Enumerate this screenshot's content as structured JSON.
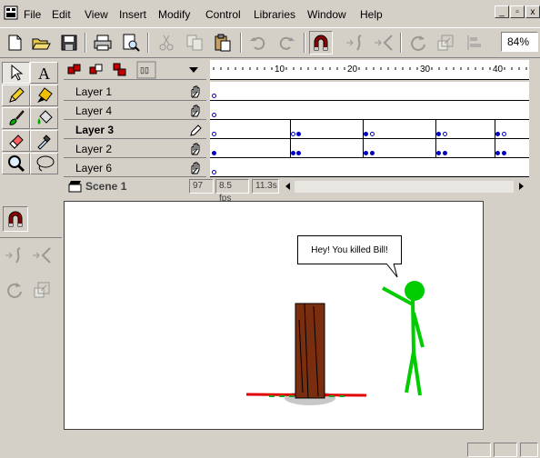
{
  "menu": [
    "File",
    "Edit",
    "View",
    "Insert",
    "Modify",
    "Control",
    "Libraries",
    "Window",
    "Help"
  ],
  "window_controls": [
    "_",
    "▫",
    "x"
  ],
  "toolbar": {
    "icons": [
      "new-icon",
      "open-icon",
      "save-icon",
      "print-icon",
      "print-preview-icon",
      "cut-icon",
      "copy-icon",
      "paste-icon",
      "undo-icon",
      "redo-icon",
      "snap-magnet-icon",
      "smooth-icon",
      "straighten-icon",
      "rotate-icon",
      "scale-icon",
      "align-icon"
    ],
    "zoom": "84%"
  },
  "tools": [
    "arrow-tool",
    "text-tool",
    "pencil-tool",
    "ink-bottle-tool",
    "brush-tool",
    "paint-bucket-tool",
    "eraser-tool",
    "dropper-tool",
    "magnifier-tool",
    "lasso-tool"
  ],
  "timeline": {
    "header_icons": [
      "show-all-layers-icon",
      "lock-all-layers-icon",
      "outline-all-layers-icon",
      "onion-skin-icon",
      "layer-menu-chevron-icon"
    ],
    "ruler_labels": [
      "10",
      "20",
      "30",
      "40"
    ],
    "layers": [
      {
        "name": "Layer 1",
        "bold": false,
        "mode": "hand"
      },
      {
        "name": "Layer 4",
        "bold": false,
        "mode": "hand"
      },
      {
        "name": "Layer 3",
        "bold": true,
        "mode": "pencil"
      },
      {
        "name": "Layer 2",
        "bold": false,
        "mode": "hand"
      },
      {
        "name": "Layer 6",
        "bold": false,
        "mode": "hand"
      }
    ],
    "scene": "Scene 1",
    "frame": "97",
    "fps": "8.5 fps",
    "time": "11.3s"
  },
  "stage": {
    "speech_bubble": "Hey! You killed Bill!"
  },
  "colors": {
    "chrome": "#d4d0c8",
    "stick_figure": "#00cc00",
    "stump": "#7a2e10",
    "blood": "#e00000"
  }
}
